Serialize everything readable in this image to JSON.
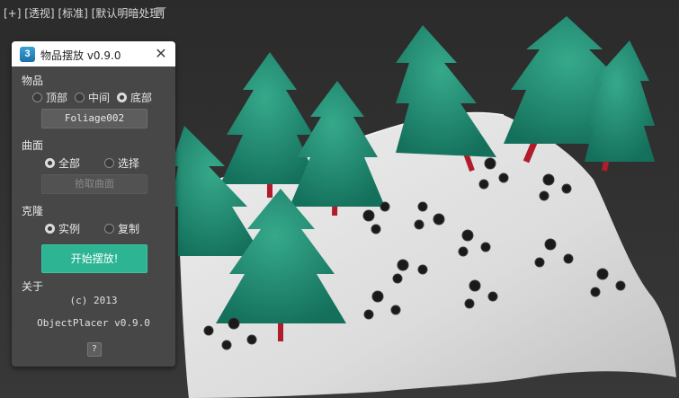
{
  "viewport": {
    "label_parts": [
      "[+]",
      "[透视]",
      "[标准]",
      "[默认明暗处理]"
    ]
  },
  "dialog": {
    "app_icon": "3",
    "title": "物品摆放 v0.9.0",
    "close_icon": "close-icon",
    "items_section": {
      "label": "物品",
      "options": [
        "顶部",
        "中间",
        "底部"
      ],
      "selected": "底部",
      "object_button": "Foliage002"
    },
    "surface_section": {
      "label": "曲面",
      "options": [
        "全部",
        "选择"
      ],
      "selected": "全部",
      "pick_button": "拾取曲面"
    },
    "clone_section": {
      "label": "克隆",
      "options": [
        "实例",
        "复制"
      ],
      "selected": "实例"
    },
    "start_button": "开始摆放!",
    "about_section": {
      "label": "关于",
      "copyright": "(c) 2013",
      "version": "ObjectPlacer v0.9.0",
      "help": "?"
    }
  },
  "colors": {
    "accent": "#2db593",
    "tree_foliage": "#1f8c74",
    "trunk": "#b01c2c",
    "ground": "#e6e6e6",
    "background": "#2e2e2e"
  }
}
